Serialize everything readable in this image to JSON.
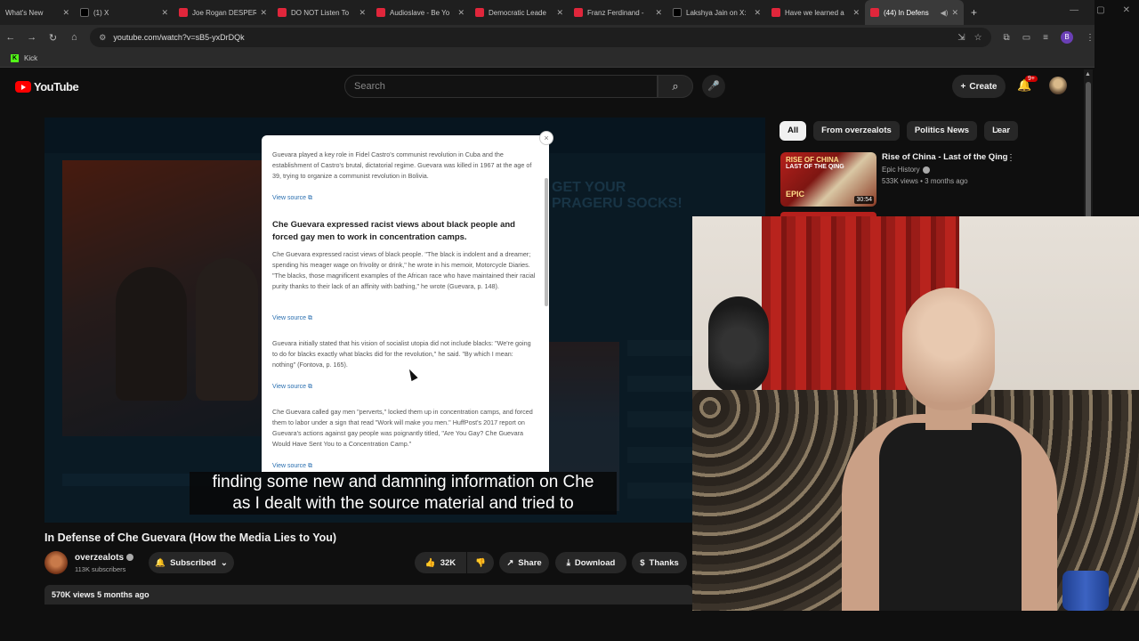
{
  "browser": {
    "tabs": [
      {
        "label": "What's New",
        "icon": "generic-icon",
        "active": false
      },
      {
        "label": "(1) X",
        "icon": "x-icon",
        "active": false
      },
      {
        "label": "Joe Rogan DESPER",
        "icon": "youtube-icon",
        "active": false
      },
      {
        "label": "DO NOT Listen To",
        "icon": "youtube-icon",
        "active": false
      },
      {
        "label": "Audioslave - Be Yo",
        "icon": "youtube-icon",
        "active": false
      },
      {
        "label": "Democratic Leade",
        "icon": "youtube-icon",
        "active": false
      },
      {
        "label": "Franz Ferdinand -",
        "icon": "youtube-icon",
        "active": false
      },
      {
        "label": "Lakshya Jain on X:",
        "icon": "x-icon",
        "active": false
      },
      {
        "label": "Have we learned a",
        "icon": "youtube-icon",
        "active": false
      },
      {
        "label": "(44) In Defens",
        "icon": "youtube-icon",
        "active": true
      }
    ],
    "new_tab": "+",
    "url": "youtube.com/watch?v=sB5-yxDrDQk",
    "bookmark": "Kick",
    "profile_initial": "B"
  },
  "youtube": {
    "logo_text": "YouTube",
    "search_placeholder": "Search",
    "create_label": "Create",
    "notification_count": "9+"
  },
  "popup": {
    "p1": "Guevara played a key role in Fidel Castro's communist revolution in Cuba and the establishment of Castro's brutal, dictatorial regime. Guevara was killed in 1967 at the age of 39, trying to organize a communist revolution in Bolivia.",
    "view_source": "View source",
    "heading": "Che Guevara expressed racist views about black people and forced gay men to work in concentration camps.",
    "p2": "Che Guevara expressed racist views of black people. \"The black is indolent and a dreamer; spending his meager wage on frivolity or drink,\" he wrote in his memoir, Motorcycle Diaries. \"The blacks, those magnificent examples of the African race who have maintained their racial purity thanks to their lack of an affinity with bathing,\" he wrote (Guevara, p. 148).",
    "p3": "Guevara initially stated that his vision of socialist utopia did not include blacks: \"We're going to do for blacks exactly what blacks did for the revolution,\" he said. \"By which I mean: nothing\" (Fontova, p. 165).",
    "p4": "Che Guevara called gay men \"perverts,\" locked them up in concentration camps, and forced them to labor under a sign that read \"Work will make you men.\" HuffPost's 2017 report on Guevara's actions against gay people was poignantly titled, \"Are You Gay? Che Guevara Would Have Sent You to a Concentration Camp.\"",
    "close": "×"
  },
  "player_promo": "GET YOUR PRAGERU SOCKS!",
  "captions": {
    "line1": "finding some new and damning information on Che",
    "line2": "as I dealt with the source material and tried to"
  },
  "video": {
    "title": "In Defense of Che Guevara (How the Media Lies to You)",
    "channel": "overzealots",
    "subscribers": "113K subscribers",
    "subscribed_label": "Subscribed",
    "likes": "32K",
    "share_label": "Share",
    "download_label": "Download",
    "thanks_label": "Thanks",
    "views": "570K views",
    "age": "5 months ago"
  },
  "sidebar": {
    "chips": [
      "All",
      "From overzealots",
      "Politics News",
      "Lear"
    ],
    "rec": {
      "title": "Rise of China - Last of the Qing",
      "channel": "Epic History",
      "meta": "533K views • 3 months ago",
      "duration": "30:54",
      "thumb_line1": "RISE OF CHINA",
      "thumb_line2": "LAST OF THE QING",
      "thumb_line3": "EPIC"
    }
  },
  "colors": {
    "accent_red": "#ff0000",
    "background": "#0f0f0f",
    "link_blue": "#2a6fb0"
  }
}
